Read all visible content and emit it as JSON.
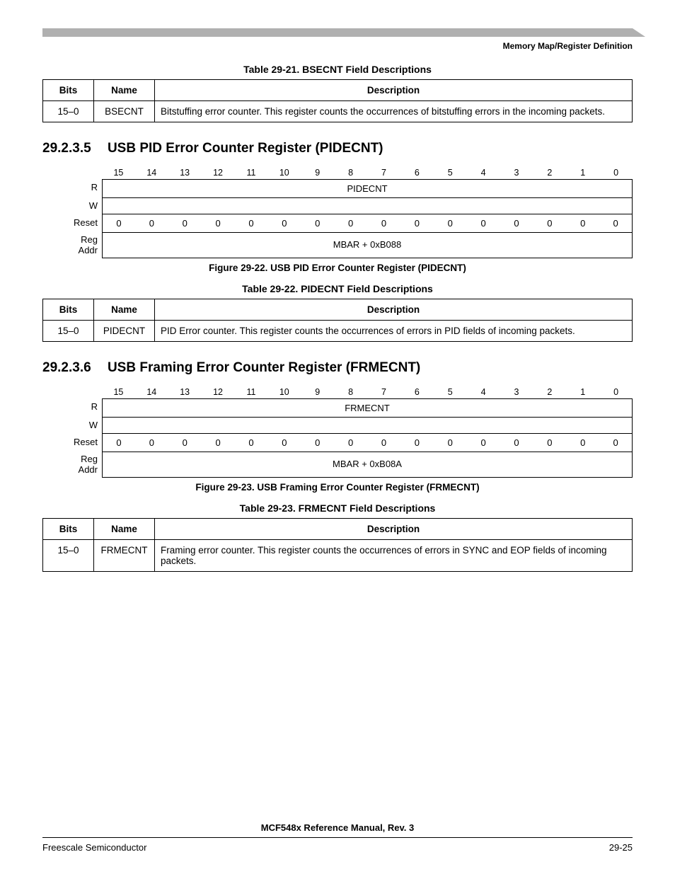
{
  "header": {
    "right": "Memory Map/Register Definition"
  },
  "table21": {
    "caption": "Table 29-21. BSECNT Field Descriptions",
    "headers": {
      "bits": "Bits",
      "name": "Name",
      "desc": "Description"
    },
    "row": {
      "bits": "15–0",
      "name": "BSECNT",
      "desc": "Bitstuffing error counter. This register counts the occurrences of bitstuffing errors in the incoming packets."
    }
  },
  "sec5": {
    "num": "29.2.3.5",
    "title": "USB PID Error Counter Register (PIDECNT)"
  },
  "reg22": {
    "bitnums": [
      "15",
      "14",
      "13",
      "12",
      "11",
      "10",
      "9",
      "8",
      "7",
      "6",
      "5",
      "4",
      "3",
      "2",
      "1",
      "0"
    ],
    "r_label": "R",
    "w_label": "W",
    "field_name": "PIDECNT",
    "reset_label": "Reset",
    "reset_vals": [
      "0",
      "0",
      "0",
      "0",
      "0",
      "0",
      "0",
      "0",
      "0",
      "0",
      "0",
      "0",
      "0",
      "0",
      "0",
      "0"
    ],
    "addr_label": "Reg Addr",
    "addr_val": "MBAR + 0xB088",
    "fig_caption": "Figure 29-22. USB PID Error Counter Register (PIDECNT)"
  },
  "table22": {
    "caption": "Table 29-22. PIDECNT Field Descriptions",
    "headers": {
      "bits": "Bits",
      "name": "Name",
      "desc": "Description"
    },
    "row": {
      "bits": "15–0",
      "name": "PIDECNT",
      "desc": "PID Error counter. This register counts the occurrences of errors in PID fields of incoming packets."
    }
  },
  "sec6": {
    "num": "29.2.3.6",
    "title": "USB Framing Error Counter Register (FRMECNT)"
  },
  "reg23": {
    "bitnums": [
      "15",
      "14",
      "13",
      "12",
      "11",
      "10",
      "9",
      "8",
      "7",
      "6",
      "5",
      "4",
      "3",
      "2",
      "1",
      "0"
    ],
    "r_label": "R",
    "w_label": "W",
    "field_name": "FRMECNT",
    "reset_label": "Reset",
    "reset_vals": [
      "0",
      "0",
      "0",
      "0",
      "0",
      "0",
      "0",
      "0",
      "0",
      "0",
      "0",
      "0",
      "0",
      "0",
      "0",
      "0"
    ],
    "addr_label": "Reg Addr",
    "addr_val": "MBAR + 0xB08A",
    "fig_caption": "Figure 29-23. USB Framing Error Counter Register (FRMECNT)"
  },
  "table23": {
    "caption": "Table 29-23. FRMECNT Field Descriptions",
    "headers": {
      "bits": "Bits",
      "name": "Name",
      "desc": "Description"
    },
    "row": {
      "bits": "15–0",
      "name": "FRMECNT",
      "desc": "Framing error counter. This register counts the occurrences of errors in SYNC and EOP fields of incoming packets."
    }
  },
  "footer": {
    "title": "MCF548x Reference Manual, Rev. 3",
    "left": "Freescale Semiconductor",
    "right": "29-25"
  }
}
